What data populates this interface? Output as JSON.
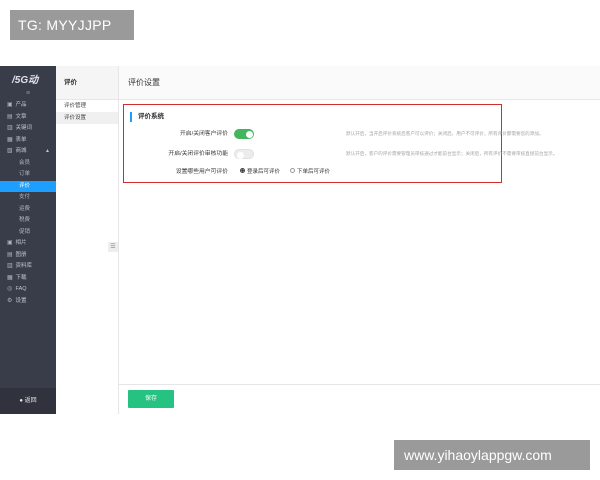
{
  "watermark_top": "TG: MYYJJPP",
  "watermark_bottom": "www.yihaoylappgw.com",
  "sidebar": {
    "logo": "/5G动",
    "collapse_icon": "≡",
    "items": [
      {
        "icon": "▣",
        "label": "产品"
      },
      {
        "icon": "▤",
        "label": "文章"
      },
      {
        "icon": "▥",
        "label": "关键词"
      },
      {
        "icon": "▦",
        "label": "表单"
      },
      {
        "icon": "▧",
        "label": "商城",
        "caret": "▲"
      }
    ],
    "mall_children": [
      "会员",
      "订单",
      "评价",
      "支付",
      "运费",
      "税费",
      "促销"
    ],
    "active_child": "评价",
    "items_after": [
      {
        "icon": "▣",
        "label": "相片"
      },
      {
        "icon": "▤",
        "label": "图册"
      },
      {
        "icon": "▥",
        "label": "资料库"
      },
      {
        "icon": "▦",
        "label": "下载"
      },
      {
        "icon": "◎",
        "label": "FAQ"
      },
      {
        "icon": "⚙",
        "label": "设置"
      }
    ],
    "back_icon": "●",
    "back_label": "返回"
  },
  "subnav": {
    "title": "评价",
    "items": [
      "评价管理",
      "评价设置"
    ],
    "current": "评价设置",
    "toggle_icon": "☰"
  },
  "main": {
    "page_title": "评价设置",
    "section_title": "评价系统",
    "rows": [
      {
        "label": "开启/关闭客户评价",
        "switch_on": true,
        "hint": "默认开启，当开启评价系统后客户可以评价；关闭后，用户不可评价，所有评价都需要您的添加。"
      },
      {
        "label": "开启/关闭评价审核功能",
        "switch_on": false,
        "hint": "默认开启，客户的评价需要管理员审核通过才能前台显示；关闭后，所有评价不需要审核直接前台显示。"
      },
      {
        "label": "设置哪些用户可评价",
        "options": [
          "登录后可评价",
          "下单后可评价"
        ],
        "selected": "登录后可评价"
      }
    ],
    "save_label": "保存"
  },
  "colors": {
    "sidebar_bg": "#393d49",
    "active_blue": "#1e9fff",
    "switch_green": "#43b55c",
    "save_green": "#26c281",
    "highlight_red": "#d42b2b"
  }
}
